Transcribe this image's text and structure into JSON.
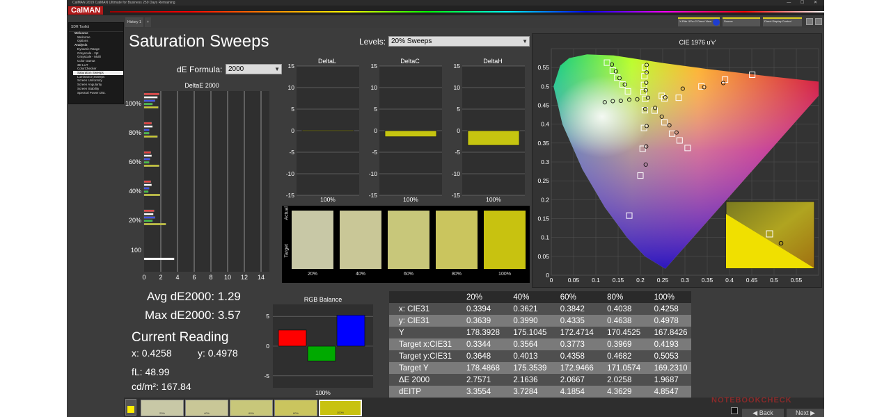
{
  "window": {
    "title": "CalMAN 2019 CalMAN Ultimate for Business 259 Days Remaining",
    "controls": "— ☐ ✕"
  },
  "brand": {
    "logo": "CalMAN"
  },
  "topbar": {
    "history_tab": "History 1",
    "add_tab": "+",
    "dropdowns": [
      "X-Rite i1Pro 2 Direct View",
      "Source",
      "Direct Display Control"
    ]
  },
  "sidebar": {
    "title": "SDR Toolkit",
    "items": [
      {
        "label": "Welcome",
        "level": 1
      },
      {
        "label": "Welcome",
        "level": 2
      },
      {
        "label": "Options",
        "level": 2
      },
      {
        "label": "Analysis",
        "level": 1
      },
      {
        "label": "Dynamic Range",
        "level": 2
      },
      {
        "label": "Grayscale - 2pt",
        "level": 2
      },
      {
        "label": "Grayscale - Multi",
        "level": 2
      },
      {
        "label": "Color Gamut",
        "level": 2
      },
      {
        "label": "3D LUT",
        "level": 2
      },
      {
        "label": "ColorChecker",
        "level": 2
      },
      {
        "label": "Saturation Sweeps",
        "level": 2,
        "selected": true
      },
      {
        "label": "Luminance Sweeps",
        "level": 2
      },
      {
        "label": "Screen Uniformity",
        "level": 2
      },
      {
        "label": "Screen Angularity",
        "level": 2
      },
      {
        "label": "Screen Stability",
        "level": 2
      },
      {
        "label": "Spectral Power Dist.",
        "level": 2
      }
    ]
  },
  "main": {
    "title": "Saturation Sweeps",
    "levels_label": "Levels:",
    "levels_value": "20% Sweeps",
    "formula_label": "dE Formula:",
    "formula_value": "2000",
    "avg_de": "Avg dE2000: 1.29",
    "max_de": "Max dE2000: 3.57",
    "current_reading": "Current Reading",
    "x_reading": "x: 0.4258",
    "y_reading": "y: 0.4978",
    "fl": "fL: 48.99",
    "cdm2": "cd/m²: 167.84"
  },
  "chart_data": [
    {
      "type": "bar",
      "title": "DeltaE 2000",
      "categories": [
        "100%",
        "80%",
        "60%",
        "40%",
        "20%",
        "100"
      ],
      "xlim": [
        0,
        15
      ],
      "xticks": [
        "0",
        "2",
        "4",
        "6",
        "8",
        "10",
        "12",
        "14"
      ],
      "bar_groups": [
        [
          {
            "color": "#e84040",
            "v": 1.8
          },
          {
            "color": "#ffffff",
            "v": 1.6
          },
          {
            "color": "#4050e8",
            "v": 1.3
          },
          {
            "color": "#40c040",
            "v": 1.0
          },
          {
            "color": "#c8c830",
            "v": 1.7
          }
        ],
        [
          {
            "color": "#e84040",
            "v": 0.9
          },
          {
            "color": "#ffffff",
            "v": 1.0
          },
          {
            "color": "#4050e8",
            "v": 0.6
          },
          {
            "color": "#40c040",
            "v": 0.6
          },
          {
            "color": "#c8c830",
            "v": 1.6
          }
        ],
        [
          {
            "color": "#e84040",
            "v": 0.8
          },
          {
            "color": "#ffffff",
            "v": 0.9
          },
          {
            "color": "#4050e8",
            "v": 0.7
          },
          {
            "color": "#40c040",
            "v": 0.6
          },
          {
            "color": "#c8c830",
            "v": 1.8
          }
        ],
        [
          {
            "color": "#e84040",
            "v": 0.8
          },
          {
            "color": "#ffffff",
            "v": 0.9
          },
          {
            "color": "#4050e8",
            "v": 0.6
          },
          {
            "color": "#40c040",
            "v": 0.5
          },
          {
            "color": "#c8c830",
            "v": 1.9
          }
        ],
        [
          {
            "color": "#e84040",
            "v": 1.2
          },
          {
            "color": "#ffffff",
            "v": 1.1
          },
          {
            "color": "#4050e8",
            "v": 1.3
          },
          {
            "color": "#40c040",
            "v": 1.0
          },
          {
            "color": "#c8c830",
            "v": 2.6
          }
        ],
        [
          {
            "color": "#ffffff",
            "v": 3.6
          }
        ]
      ]
    },
    {
      "type": "bar",
      "title": "DeltaL",
      "categories": [
        "100%"
      ],
      "values": [
        0.1
      ],
      "ylim": [
        -15,
        15
      ],
      "yticks": [
        "15",
        "10",
        "5",
        "0",
        "-5",
        "-10",
        "-15"
      ]
    },
    {
      "type": "bar",
      "title": "DeltaC",
      "categories": [
        "100%"
      ],
      "values": [
        -1.4
      ],
      "ylim": [
        -15,
        15
      ],
      "yticks": [
        "15",
        "10",
        "5",
        "0",
        "-5",
        "-10",
        "-15"
      ]
    },
    {
      "type": "bar",
      "title": "DeltaH",
      "categories": [
        "100%"
      ],
      "values": [
        -3.4
      ],
      "ylim": [
        -15,
        15
      ],
      "yticks": [
        "15",
        "10",
        "5",
        "0",
        "-5",
        "-10",
        "-15"
      ]
    },
    {
      "type": "bar",
      "title": "RGB Balance",
      "categories": [
        "100%"
      ],
      "series": [
        {
          "color": "#ff0000",
          "values": [
            2.7
          ]
        },
        {
          "color": "#00aa00",
          "values": [
            -2.5
          ]
        },
        {
          "color": "#0000ff",
          "values": [
            5.2
          ]
        }
      ],
      "ylim": [
        -7,
        7
      ],
      "yticks": [
        "5",
        "0",
        "-5"
      ]
    },
    {
      "type": "scatter",
      "title": "CIE 1976 u'v'",
      "xlim": [
        0,
        0.6
      ],
      "ylim": [
        0,
        0.6
      ],
      "xticks": [
        "0",
        "0.05",
        "0.1",
        "0.15",
        "0.2",
        "0.25",
        "0.3",
        "0.35",
        "0.4",
        "0.45",
        "0.5",
        "0.55"
      ],
      "yticks": [
        "0",
        "0.05",
        "0.1",
        "0.15",
        "0.2",
        "0.25",
        "0.3",
        "0.35",
        "0.4",
        "0.45",
        "0.5",
        "0.55"
      ],
      "target_squares": [
        [
          0.125,
          0.563
        ],
        [
          0.138,
          0.542
        ],
        [
          0.148,
          0.523
        ],
        [
          0.16,
          0.505
        ],
        [
          0.172,
          0.487
        ],
        [
          0.211,
          0.467
        ],
        [
          0.21,
          0.437
        ],
        [
          0.208,
          0.39
        ],
        [
          0.205,
          0.335
        ],
        [
          0.2,
          0.264
        ],
        [
          0.175,
          0.158
        ],
        [
          0.21,
          0.55
        ],
        [
          0.209,
          0.527
        ],
        [
          0.208,
          0.504
        ],
        [
          0.207,
          0.485
        ],
        [
          0.248,
          0.475
        ],
        [
          0.254,
          0.468
        ],
        [
          0.286,
          0.47
        ],
        [
          0.337,
          0.5
        ],
        [
          0.39,
          0.518
        ],
        [
          0.451,
          0.531
        ],
        [
          0.232,
          0.436
        ],
        [
          0.254,
          0.405
        ],
        [
          0.271,
          0.375
        ],
        [
          0.288,
          0.357
        ],
        [
          0.306,
          0.337
        ]
      ],
      "measured_circles": [
        [
          0.136,
          0.558
        ],
        [
          0.145,
          0.54
        ],
        [
          0.153,
          0.522
        ],
        [
          0.165,
          0.505
        ],
        [
          0.217,
          0.47
        ],
        [
          0.211,
          0.44
        ],
        [
          0.214,
          0.395
        ],
        [
          0.213,
          0.341
        ],
        [
          0.212,
          0.293
        ],
        [
          0.214,
          0.557
        ],
        [
          0.214,
          0.537
        ],
        [
          0.213,
          0.51
        ],
        [
          0.212,
          0.49
        ],
        [
          0.256,
          0.471
        ],
        [
          0.295,
          0.494
        ],
        [
          0.343,
          0.498
        ],
        [
          0.386,
          0.509
        ],
        [
          0.12,
          0.458
        ],
        [
          0.138,
          0.461
        ],
        [
          0.156,
          0.462
        ],
        [
          0.175,
          0.465
        ],
        [
          0.193,
          0.466
        ],
        [
          0.233,
          0.443
        ],
        [
          0.248,
          0.42
        ],
        [
          0.265,
          0.397
        ],
        [
          0.281,
          0.378
        ]
      ]
    },
    {
      "type": "table",
      "columns": [
        "",
        "20%",
        "40%",
        "60%",
        "80%",
        "100%"
      ],
      "rows": [
        [
          "x: CIE31",
          "0.3394",
          "0.3621",
          "0.3842",
          "0.4038",
          "0.4258"
        ],
        [
          "y: CIE31",
          "0.3639",
          "0.3990",
          "0.4335",
          "0.4638",
          "0.4978"
        ],
        [
          "Y",
          "178.3928",
          "175.1045",
          "172.4714",
          "170.4525",
          "167.8426"
        ],
        [
          "Target x:CIE31",
          "0.3344",
          "0.3564",
          "0.3773",
          "0.3969",
          "0.4193"
        ],
        [
          "Target y:CIE31",
          "0.3648",
          "0.4013",
          "0.4358",
          "0.4682",
          "0.5053"
        ],
        [
          "Target Y",
          "178.4868",
          "175.3539",
          "172.9466",
          "171.0574",
          "169.2310"
        ],
        [
          "ΔE 2000",
          "2.7571",
          "2.1636",
          "2.0667",
          "2.0258",
          "1.9687"
        ],
        [
          "dEITP",
          "3.3554",
          "3.7284",
          "4.1854",
          "4.3629",
          "4.8547"
        ]
      ]
    }
  ],
  "swatches": {
    "labels": [
      "20%",
      "40%",
      "60%",
      "80%",
      "100%"
    ],
    "actual_label": "Actual",
    "target_label": "Target",
    "colors": [
      "#c8c8a6",
      "#c9c797",
      "#c8c77a",
      "#cac55e",
      "#c8c210"
    ]
  },
  "bottom": {
    "thumbs": [
      "20%",
      "40%",
      "60%",
      "80%",
      "100%"
    ],
    "thumb_colors": [
      "#c8c8a6",
      "#c9c797",
      "#c8c77a",
      "#cac55e",
      "#c8c210"
    ],
    "back": "Back",
    "next": "Next"
  },
  "watermark": "NOTEBOOKCHECK"
}
